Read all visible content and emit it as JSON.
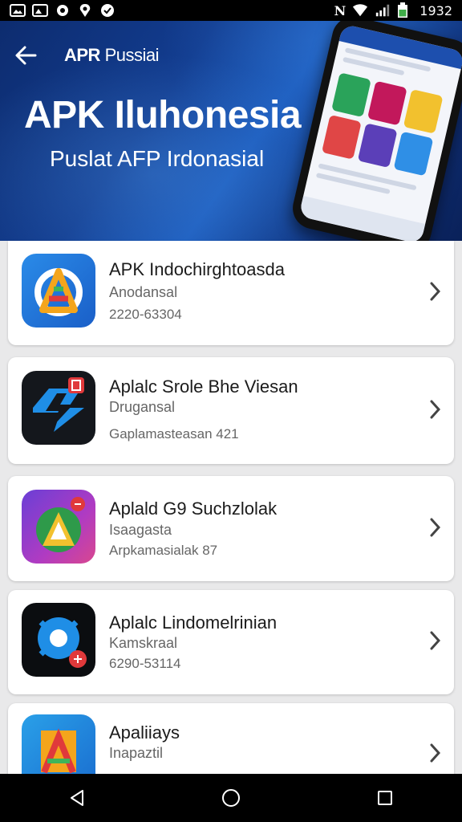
{
  "status_bar": {
    "time": "1932",
    "nfc": "N"
  },
  "header": {
    "brand_bold": "APR",
    "brand_rest": " Pussiai",
    "title": "APK Iluhonesia",
    "subtitle": "Puslat AFP Irdonasial"
  },
  "apps": [
    {
      "title": "APK Indochirghtoasda",
      "line1": "Anodansal",
      "line2": "2220-63304"
    },
    {
      "title": "Aplalc Srole Bhe Viesan",
      "line1": "Drugansal",
      "line2": "Gaplamasteasan 421"
    },
    {
      "title": "Aplald G9 Suchzlolak",
      "line1": "Isaagasta",
      "line2": "Arpkamasialak 87"
    },
    {
      "title": "Aplalc Lindomelrinian",
      "line1": "Kamskraal",
      "line2": "6290-53114"
    },
    {
      "title": "Apaliiays",
      "line1": "Inapaztil",
      "line2": ""
    }
  ],
  "icons": {
    "back": "arrow-left-icon",
    "chevron": "chevron-right-icon",
    "nav": [
      "back-triangle-icon",
      "home-circle-icon",
      "recents-square-icon"
    ]
  },
  "colors": {
    "banner": "#123c8f",
    "accent": "#1d4fae"
  }
}
